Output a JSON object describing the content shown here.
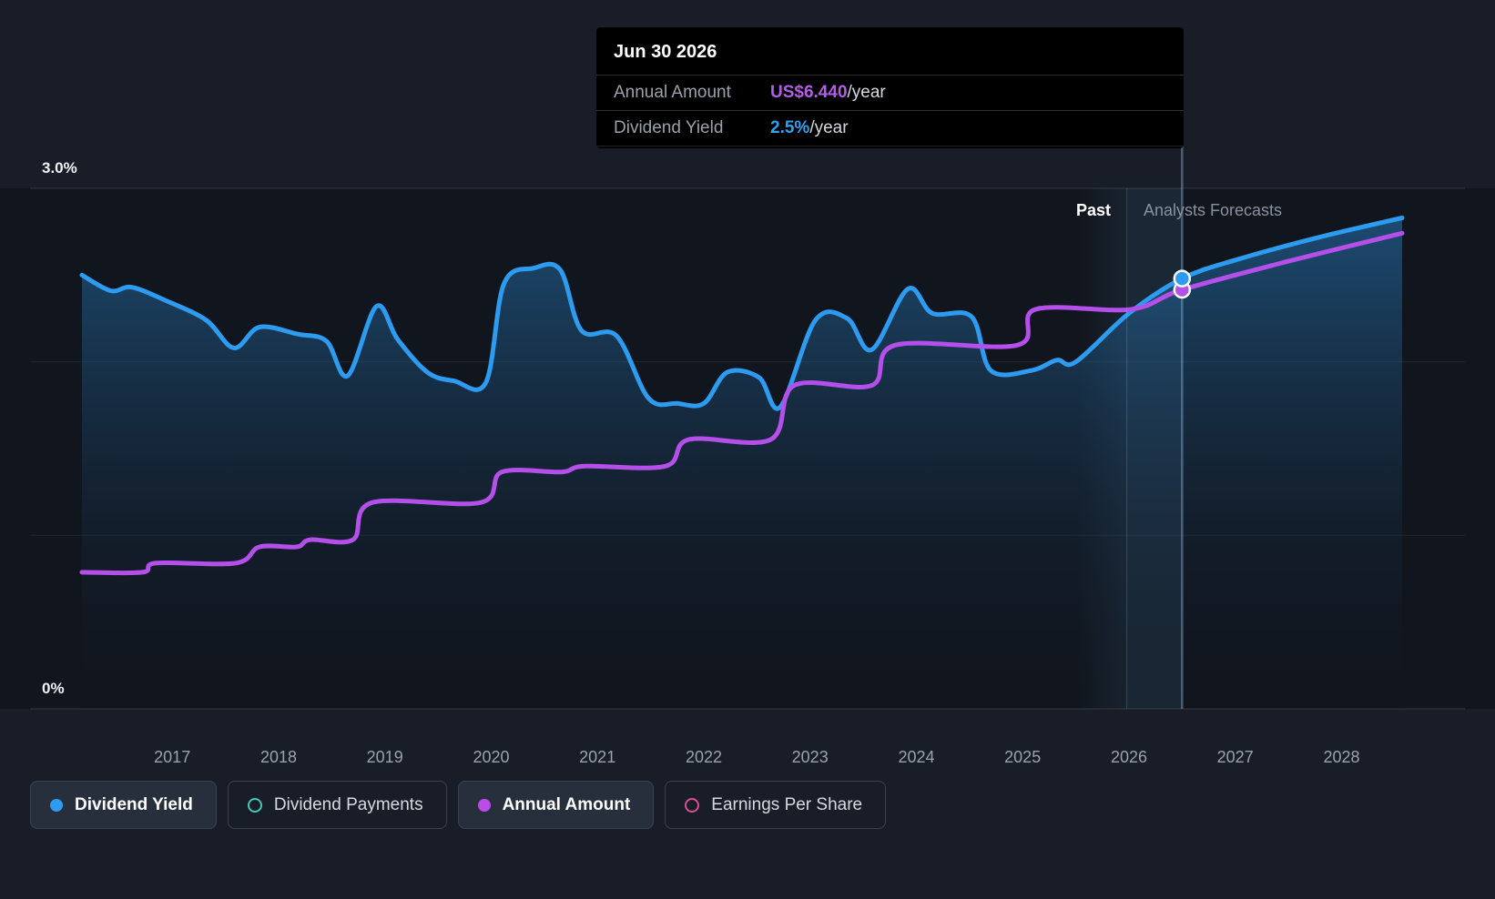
{
  "tooltip": {
    "date": "Jun 30 2026",
    "rows": [
      {
        "label": "Annual Amount",
        "value": "US$6.440",
        "suffix": "/year",
        "color": "#b45ce8"
      },
      {
        "label": "Dividend Yield",
        "value": "2.5%",
        "suffix": "/year",
        "color": "#2aa3f5"
      }
    ]
  },
  "labels": {
    "past": "Past",
    "forecast": "Analysts Forecasts",
    "y_top": "3.0%",
    "y_bottom": "0%"
  },
  "legend": [
    {
      "label": "Dividend Yield",
      "style": "filled",
      "color": "#2d9bf0",
      "active": true
    },
    {
      "label": "Dividend Payments",
      "style": "outline",
      "color": "#46c6b5",
      "active": false
    },
    {
      "label": "Annual Amount",
      "style": "filled",
      "color": "#bb4ce8",
      "active": true
    },
    {
      "label": "Earnings Per Share",
      "style": "outline",
      "color": "#d84f93",
      "active": false
    }
  ],
  "chart_data": {
    "type": "line",
    "x": {
      "min": 2016.15,
      "max": 2028.57,
      "ticks": [
        2017,
        2018,
        2019,
        2020,
        2021,
        2022,
        2023,
        2024,
        2025,
        2026,
        2027,
        2028
      ]
    },
    "y_yield": {
      "min": 0,
      "max": 3.0,
      "unit": "%",
      "gridlines": [
        0,
        1,
        2,
        3
      ],
      "top_label": "3.0%",
      "bottom_label": "0%"
    },
    "y_amount": {
      "min": 0,
      "max": 8.0,
      "unit": "US$"
    },
    "divider_year": 2025.98,
    "hover": {
      "year": 2026.5,
      "date_label": "Jun 30 2026"
    },
    "grid": "horizontal-only",
    "legend_position": "bottom",
    "series": [
      {
        "name": "Dividend Yield",
        "axis": "yield",
        "color": "#2d9bf0",
        "smooth": true,
        "area": true,
        "points": [
          [
            2016.15,
            2.5
          ],
          [
            2016.42,
            2.41
          ],
          [
            2016.62,
            2.43
          ],
          [
            2016.95,
            2.35
          ],
          [
            2017.32,
            2.24
          ],
          [
            2017.58,
            2.08
          ],
          [
            2017.82,
            2.2
          ],
          [
            2018.18,
            2.16
          ],
          [
            2018.45,
            2.12
          ],
          [
            2018.65,
            1.92
          ],
          [
            2018.92,
            2.32
          ],
          [
            2019.12,
            2.13
          ],
          [
            2019.4,
            1.94
          ],
          [
            2019.65,
            1.89
          ],
          [
            2019.95,
            1.88
          ],
          [
            2020.12,
            2.45
          ],
          [
            2020.4,
            2.54
          ],
          [
            2020.65,
            2.53
          ],
          [
            2020.85,
            2.18
          ],
          [
            2021.18,
            2.15
          ],
          [
            2021.48,
            1.79
          ],
          [
            2021.75,
            1.76
          ],
          [
            2022.0,
            1.76
          ],
          [
            2022.22,
            1.94
          ],
          [
            2022.52,
            1.91
          ],
          [
            2022.72,
            1.74
          ],
          [
            2023.05,
            2.24
          ],
          [
            2023.35,
            2.25
          ],
          [
            2023.58,
            2.07
          ],
          [
            2023.92,
            2.42
          ],
          [
            2024.15,
            2.28
          ],
          [
            2024.52,
            2.26
          ],
          [
            2024.7,
            1.95
          ],
          [
            2025.08,
            1.95
          ],
          [
            2025.32,
            2.01
          ],
          [
            2025.5,
            2.0
          ],
          [
            2026.0,
            2.28
          ],
          [
            2026.5,
            2.48
          ],
          [
            2027.02,
            2.59
          ],
          [
            2027.8,
            2.72
          ],
          [
            2028.57,
            2.83
          ]
        ]
      },
      {
        "name": "Annual Amount",
        "axis": "amount",
        "color": "#b44fe9",
        "smooth": true,
        "area": false,
        "points": [
          [
            2016.15,
            2.1
          ],
          [
            2016.72,
            2.1
          ],
          [
            2016.85,
            2.24
          ],
          [
            2017.6,
            2.24
          ],
          [
            2017.82,
            2.49
          ],
          [
            2018.17,
            2.49
          ],
          [
            2018.3,
            2.6
          ],
          [
            2018.7,
            2.6
          ],
          [
            2018.88,
            3.17
          ],
          [
            2019.9,
            3.17
          ],
          [
            2020.1,
            3.64
          ],
          [
            2020.66,
            3.64
          ],
          [
            2020.88,
            3.73
          ],
          [
            2021.64,
            3.73
          ],
          [
            2021.86,
            4.14
          ],
          [
            2022.63,
            4.14
          ],
          [
            2022.85,
            4.97
          ],
          [
            2023.58,
            4.97
          ],
          [
            2023.8,
            5.59
          ],
          [
            2024.95,
            5.59
          ],
          [
            2025.12,
            6.14
          ],
          [
            2026.02,
            6.14
          ],
          [
            2026.5,
            6.44
          ],
          [
            2027.5,
            6.88
          ],
          [
            2028.57,
            7.31
          ]
        ]
      }
    ],
    "markers": [
      {
        "series": "Annual Amount",
        "year": 2026.5,
        "value": 6.44
      },
      {
        "series": "Dividend Yield",
        "year": 2026.5,
        "value": 2.48
      }
    ]
  }
}
